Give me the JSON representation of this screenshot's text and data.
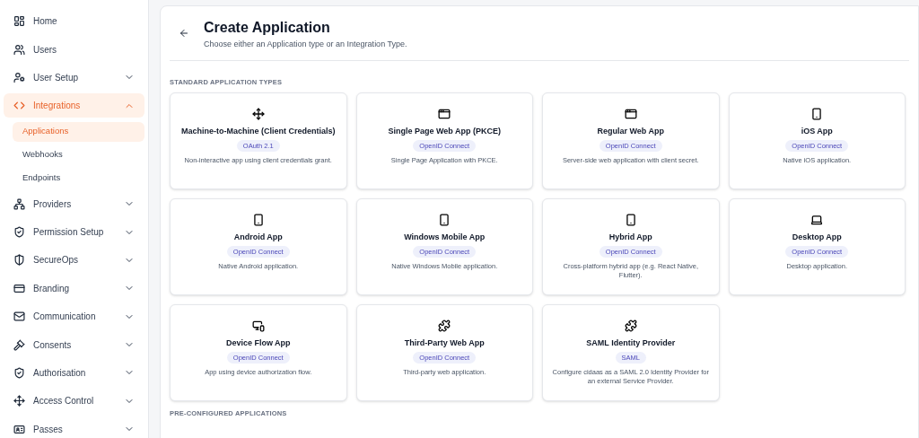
{
  "sidebar": {
    "items": [
      {
        "label": "Home",
        "kind": "home",
        "selected": false
      },
      {
        "label": "Users",
        "kind": "users",
        "selected": false
      },
      {
        "label": "User Setup",
        "kind": "usersetup",
        "selected": false,
        "expanded": false
      },
      {
        "label": "Integrations",
        "kind": "integrations",
        "selected": true,
        "expanded": true,
        "children": [
          {
            "label": "Applications",
            "selected": true
          },
          {
            "label": "Webhooks",
            "selected": false
          },
          {
            "label": "Endpoints",
            "selected": false
          }
        ]
      },
      {
        "label": "Providers",
        "kind": "providers",
        "selected": false,
        "expanded": false
      },
      {
        "label": "Permission Setup",
        "kind": "shield",
        "selected": false,
        "expanded": false
      },
      {
        "label": "SecureOps",
        "kind": "secureops",
        "selected": false,
        "expanded": false
      },
      {
        "label": "Branding",
        "kind": "branding",
        "selected": false,
        "expanded": false
      },
      {
        "label": "Communication",
        "kind": "mail",
        "selected": false,
        "expanded": false
      },
      {
        "label": "Consents",
        "kind": "gavel",
        "selected": false,
        "expanded": false
      },
      {
        "label": "Authorisation",
        "kind": "shield",
        "selected": false,
        "expanded": false
      },
      {
        "label": "Access Control",
        "kind": "move",
        "selected": false,
        "expanded": false
      },
      {
        "label": "Passes",
        "kind": "badge",
        "selected": false,
        "expanded": false
      }
    ]
  },
  "header": {
    "title": "Create Application",
    "subtitle": "Choose either an Application type or an Integration Type."
  },
  "sections": [
    {
      "heading": "STANDARD APPLICATION TYPES",
      "cards": [
        {
          "kind": "move",
          "title": "Machine-to-Machine (Client Credentials)",
          "tag": "OAuth 2.1",
          "description": "Non-interactive app using client credentials grant."
        },
        {
          "kind": "browser",
          "title": "Single Page Web App (PKCE)",
          "tag": "OpenID Connect",
          "description": "Single Page Application with PKCE."
        },
        {
          "kind": "browser",
          "title": "Regular Web App",
          "tag": "OpenID Connect",
          "description": "Server-side web application with client secret."
        },
        {
          "kind": "phone",
          "title": "iOS App",
          "tag": "OpenID Connect",
          "description": "Native iOS application."
        },
        {
          "kind": "phone",
          "title": "Android App",
          "tag": "OpenID Connect",
          "description": "Native Android application."
        },
        {
          "kind": "phone",
          "title": "Windows Mobile App",
          "tag": "OpenID Connect",
          "description": "Native Windows Mobile application."
        },
        {
          "kind": "phone",
          "title": "Hybrid App",
          "tag": "OpenID Connect",
          "description": "Cross-platform hybrid app (e.g. React Native, Flutter)."
        },
        {
          "kind": "laptop",
          "title": "Desktop App",
          "tag": "OpenID Connect",
          "description": "Desktop application."
        },
        {
          "kind": "devices",
          "title": "Device Flow App",
          "tag": "OpenID Connect",
          "description": "App using device authorization flow."
        },
        {
          "kind": "puzzle",
          "title": "Third-Party Web App",
          "tag": "OpenID Connect",
          "description": "Third-party web application."
        },
        {
          "kind": "puzzle",
          "title": "SAML Identity Provider",
          "tag": "SAML",
          "description": "Configure cidaas as a SAML 2.0 Identity Provider for an external Service Provider."
        }
      ]
    },
    {
      "heading": "PRE-CONFIGURED APPLICATIONS"
    }
  ]
}
